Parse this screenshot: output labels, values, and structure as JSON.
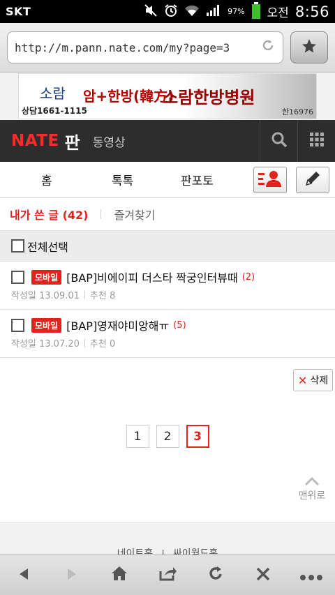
{
  "status": {
    "carrier": "SKT",
    "battery": "97%",
    "ampm": "오전",
    "time": "8:56"
  },
  "browser": {
    "url": "http://m.pann.nate.com/my?page=3"
  },
  "banner": {
    "logo": "소람",
    "phone": "상담1661-1115",
    "text1": "암+한방(韓方)",
    "text2": "소람한방병원",
    "number": "한16976"
  },
  "header": {
    "logo": "NATE",
    "pan": "판",
    "video": "동영상"
  },
  "tabs": {
    "home": "홈",
    "talk": "톡톡",
    "photo": "판포토"
  },
  "subtabs": {
    "my_posts": "내가 쓴 글 (42)",
    "favorites": "즐겨찾기"
  },
  "select_all": "전체선택",
  "posts": [
    {
      "badge": "모바일",
      "title": "[BAP]비에이피 더스타 짝궁인터뷰때",
      "comments": "(2)",
      "date": "작성일 13.09.01",
      "likes": "추천 8"
    },
    {
      "badge": "모바일",
      "title": "[BAP]영재야미앙해ㅠ",
      "comments": "(5)",
      "date": "작성일 13.07.20",
      "likes": "추천 0"
    }
  ],
  "delete_label": "삭제",
  "pagination": [
    "1",
    "2",
    "3"
  ],
  "current_page": "3",
  "top_label": "맨위로",
  "footer": {
    "link1": "네이트홈",
    "link2": "싸이월드홈"
  },
  "colors": {
    "accent": "#e3221c",
    "header_bg": "#2d2d2d"
  }
}
